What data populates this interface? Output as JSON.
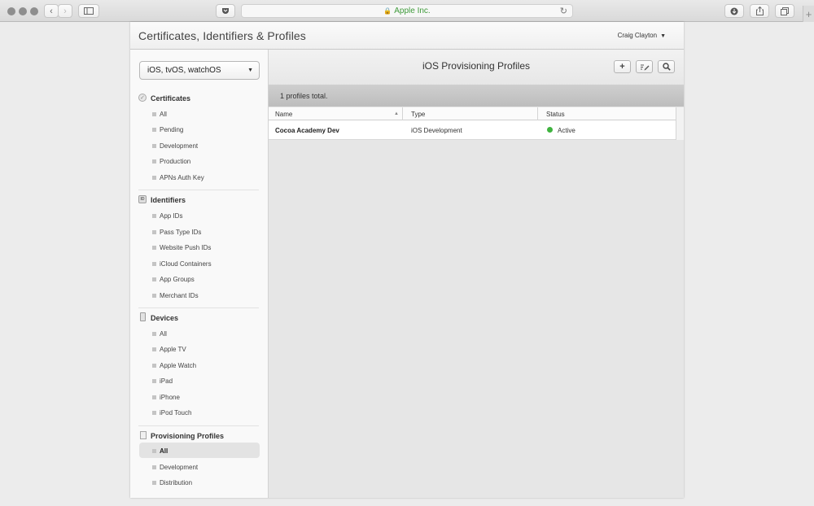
{
  "browser": {
    "address_text": "Apple Inc.",
    "new_tab": "+"
  },
  "header": {
    "title": "Certificates, Identifiers & Profiles",
    "user": "Craig Clayton"
  },
  "sidebar": {
    "platform": "iOS, tvOS, watchOS",
    "sections": [
      {
        "title": "Certificates",
        "icon": "check-circle-icon",
        "items": [
          "All",
          "Pending",
          "Development",
          "Production",
          "APNs Auth Key"
        ]
      },
      {
        "title": "Identifiers",
        "icon": "id-badge-icon",
        "icon_text": "ID",
        "items": [
          "App IDs",
          "Pass Type IDs",
          "Website Push IDs",
          "iCloud Containers",
          "App Groups",
          "Merchant IDs"
        ]
      },
      {
        "title": "Devices",
        "icon": "device-icon",
        "items": [
          "All",
          "Apple TV",
          "Apple Watch",
          "iPad",
          "iPhone",
          "iPod Touch"
        ]
      },
      {
        "title": "Provisioning Profiles",
        "icon": "document-icon",
        "items": [
          "All",
          "Development",
          "Distribution"
        ],
        "selected": "All"
      }
    ]
  },
  "main": {
    "title": "iOS Provisioning Profiles",
    "summary": "1 profiles total.",
    "columns": [
      "Name",
      "Type",
      "Status"
    ],
    "rows": [
      {
        "name": "Cocoa Academy Dev",
        "type": "iOS Development",
        "status": "Active",
        "status_color": "#3fb33f"
      }
    ]
  }
}
